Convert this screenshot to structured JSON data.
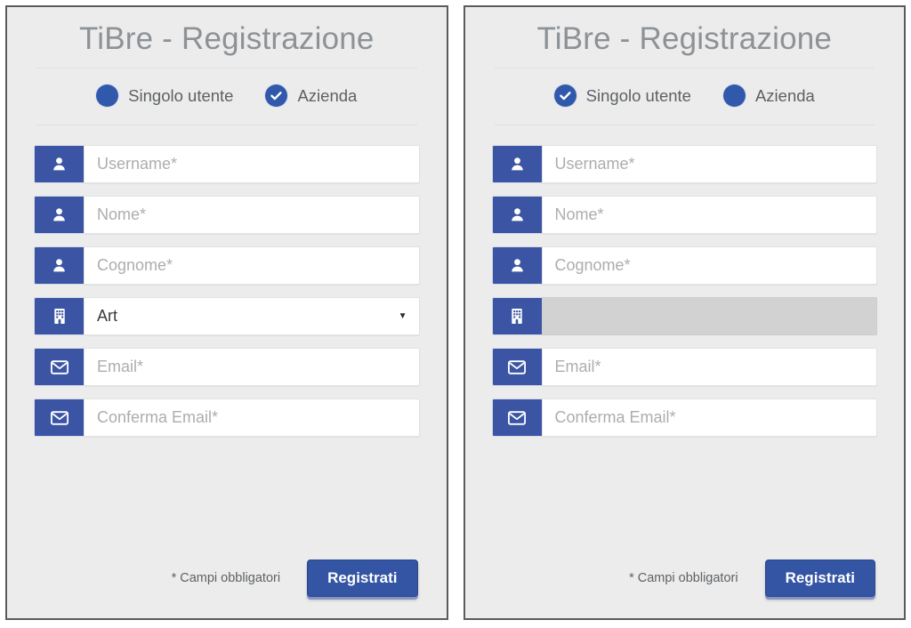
{
  "panels": [
    {
      "title": "TiBre - Registrazione",
      "options": [
        {
          "label": "Singolo utente",
          "icon": "radio-filled-icon",
          "checked": false
        },
        {
          "label": "Azienda",
          "icon": "check-circle-icon",
          "checked": true
        }
      ],
      "fields": [
        {
          "icon": "user-icon",
          "type": "text",
          "placeholder": "Username*",
          "value": "",
          "disabled": false
        },
        {
          "icon": "user-icon",
          "type": "text",
          "placeholder": "Nome*",
          "value": "",
          "disabled": false
        },
        {
          "icon": "user-icon",
          "type": "text",
          "placeholder": "Cognome*",
          "value": "",
          "disabled": false
        },
        {
          "icon": "building-icon",
          "type": "select",
          "placeholder": "",
          "value": "Art",
          "disabled": false,
          "caret": "▼"
        },
        {
          "icon": "envelope-icon",
          "type": "email",
          "placeholder": "Email*",
          "value": "",
          "disabled": false
        },
        {
          "icon": "envelope-icon",
          "type": "email",
          "placeholder": "Conferma Email*",
          "value": "",
          "disabled": false
        }
      ],
      "required_note": "* Campi obbligatori",
      "submit_label": "Registrati"
    },
    {
      "title": "TiBre - Registrazione",
      "options": [
        {
          "label": "Singolo utente",
          "icon": "check-circle-icon",
          "checked": true
        },
        {
          "label": "Azienda",
          "icon": "radio-filled-icon",
          "checked": false
        }
      ],
      "fields": [
        {
          "icon": "user-icon",
          "type": "text",
          "placeholder": "Username*",
          "value": "",
          "disabled": false
        },
        {
          "icon": "user-icon",
          "type": "text",
          "placeholder": "Nome*",
          "value": "",
          "disabled": false
        },
        {
          "icon": "user-icon",
          "type": "text",
          "placeholder": "Cognome*",
          "value": "",
          "disabled": false
        },
        {
          "icon": "building-icon",
          "type": "select",
          "placeholder": "",
          "value": "",
          "disabled": true,
          "caret": ""
        },
        {
          "icon": "envelope-icon",
          "type": "email",
          "placeholder": "Email*",
          "value": "",
          "disabled": false
        },
        {
          "icon": "envelope-icon",
          "type": "email",
          "placeholder": "Conferma Email*",
          "value": "",
          "disabled": false
        }
      ],
      "required_note": "* Campi obbligatori",
      "submit_label": "Registrati"
    }
  ],
  "colors": {
    "accent_blue": "#3b55a4",
    "radio_blue": "#3159ab",
    "panel_bg": "#ececec",
    "panel_border": "#5b5b5b",
    "title_gray": "#8d9296",
    "placeholder_gray": "#adadad",
    "disabled_gray": "#d2d2d2"
  }
}
